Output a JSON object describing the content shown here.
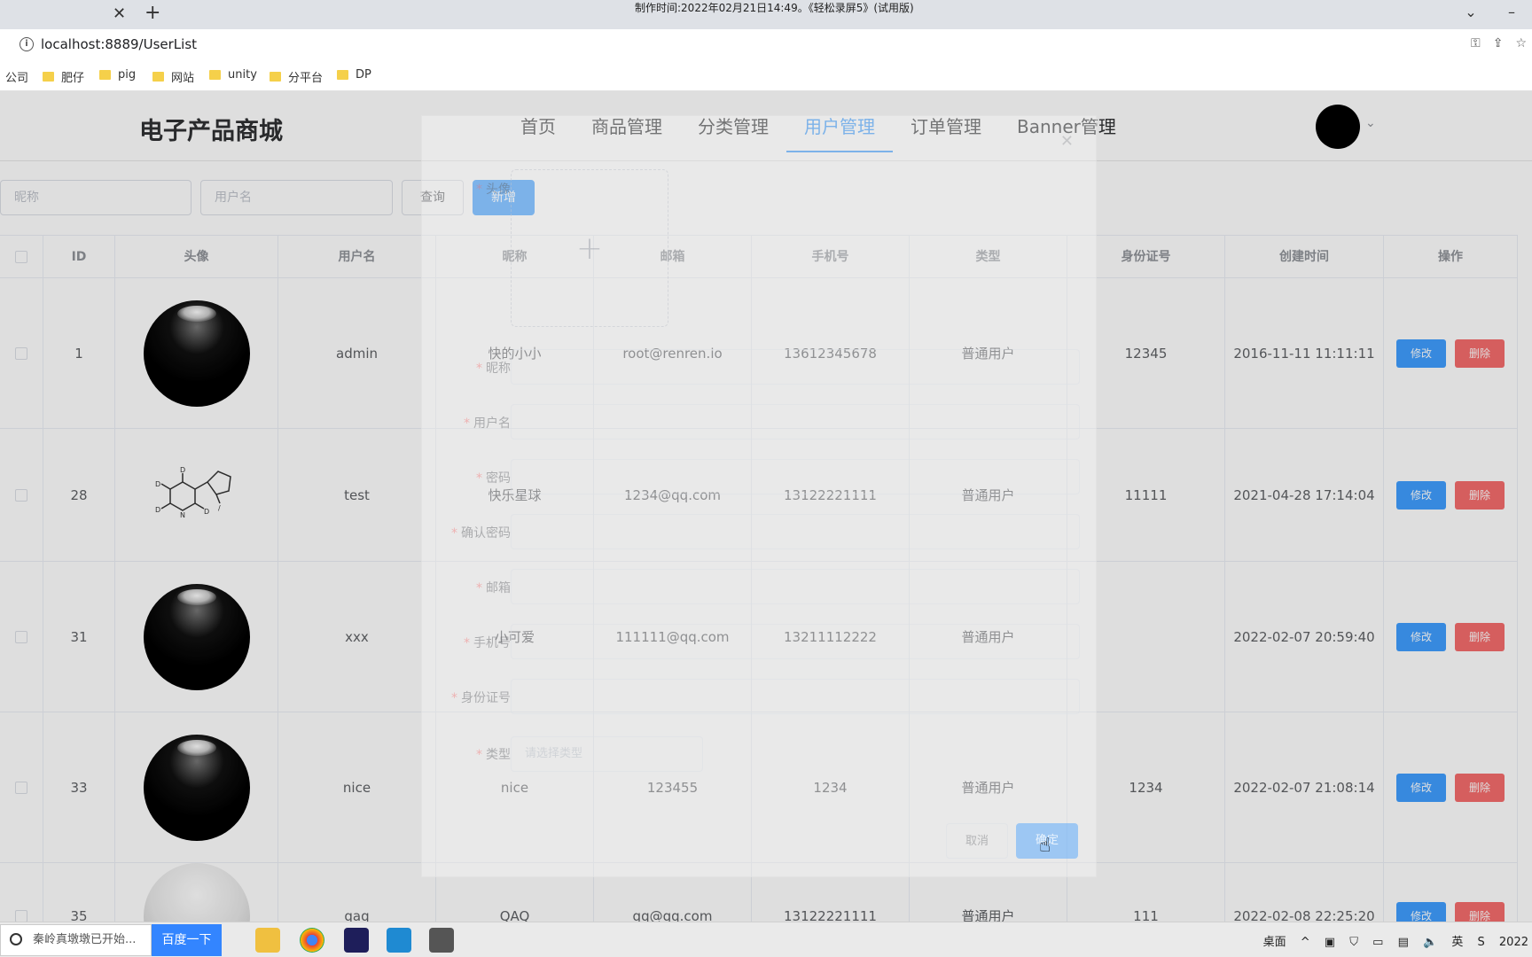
{
  "browser": {
    "recording_note": "制作时间:2022年02月21日14:49。《轻松录屏5》(试用版)",
    "url": "localhost:8889/UserList",
    "bookmarks": [
      "公司",
      "肥仔",
      "pig",
      "网站",
      "unity",
      "分平台",
      "DP"
    ]
  },
  "app": {
    "brand": "电子产品商城",
    "nav": [
      "首页",
      "商品管理",
      "分类管理",
      "用户管理",
      "订单管理",
      "Banner管理"
    ],
    "active_nav": "用户管理"
  },
  "filters": {
    "nickname_placeholder": "昵称",
    "username_placeholder": "用户名",
    "query_label": "查询",
    "add_label": "新增"
  },
  "table": {
    "headers": [
      "ID",
      "头像",
      "用户名",
      "昵称",
      "邮箱",
      "手机号",
      "类型",
      "身份证号",
      "创建时间",
      "操作"
    ],
    "edit_label": "修改",
    "delete_label": "删除",
    "rows": [
      {
        "id": "1",
        "avatar": "black-ball",
        "username": "admin",
        "nickname": "快的小小",
        "email": "root@renren.io",
        "phone": "13612345678",
        "type": "普通用户",
        "idcard": "12345",
        "created": "2016-11-11 11:11:11"
      },
      {
        "id": "28",
        "avatar": "molecule",
        "username": "test",
        "nickname": "快乐星球",
        "email": "1234@qq.com",
        "phone": "13122221111",
        "type": "普通用户",
        "idcard": "11111",
        "created": "2021-04-28 17:14:04"
      },
      {
        "id": "31",
        "avatar": "black-ball",
        "username": "xxx",
        "nickname": "小可爱",
        "email": "111111@qq.com",
        "phone": "13211112222",
        "type": "普通用户",
        "idcard": "",
        "created": "2022-02-07 20:59:40"
      },
      {
        "id": "33",
        "avatar": "black-ball",
        "username": "nice",
        "nickname": "nice",
        "email": "123455",
        "phone": "1234",
        "type": "普通用户",
        "idcard": "1234",
        "created": "2022-02-07 21:08:14"
      },
      {
        "id": "35",
        "avatar": "white-ball",
        "username": "qaq",
        "nickname": "QAQ",
        "email": "qq@qq.com",
        "phone": "13122221111",
        "type": "普通用户",
        "idcard": "111",
        "created": "2022-02-08 22:25:20"
      }
    ]
  },
  "dialog": {
    "labels": {
      "avatar": "头像",
      "nickname": "昵称",
      "username": "用户名",
      "password": "密码",
      "confirm_password": "确认密码",
      "email": "邮箱",
      "phone": "手机号",
      "idcard": "身份证号",
      "type": "类型"
    },
    "type_placeholder": "请选择类型",
    "cancel_label": "取消",
    "confirm_label": "确定"
  },
  "taskbar": {
    "search_text": "秦岭真墩墩已开始...",
    "baidu_label": "百度一下",
    "desktop_label": "桌面",
    "ime_label": "英",
    "clock_partial": "2022"
  }
}
